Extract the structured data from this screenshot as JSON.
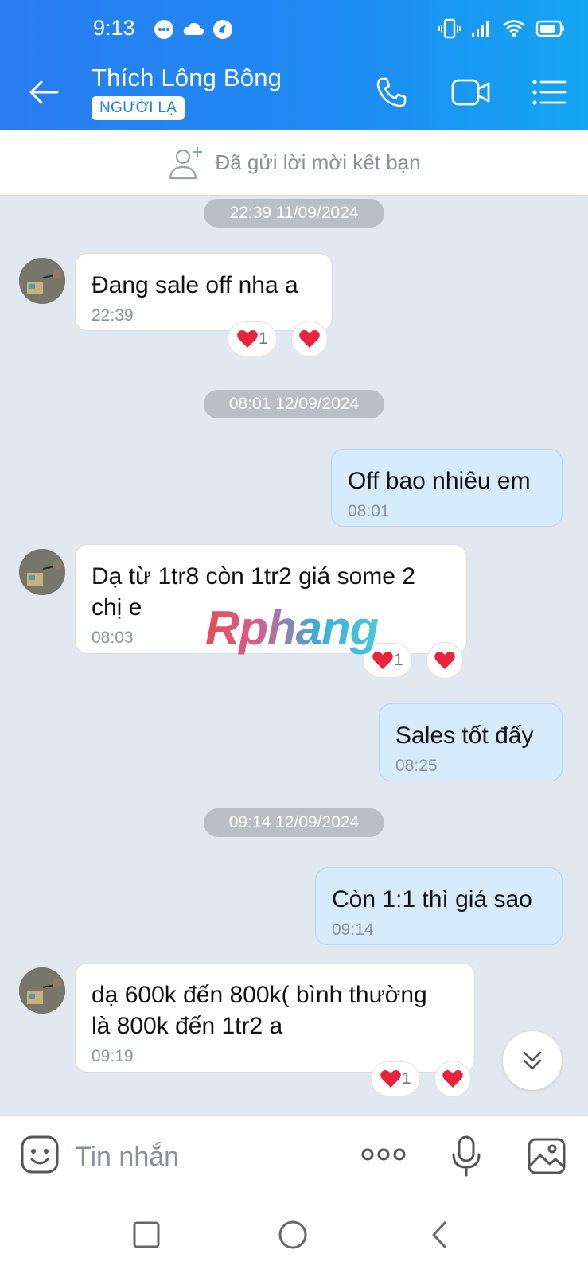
{
  "status_bar": {
    "time": "9:13",
    "icons_left": [
      "messenger-icon",
      "cloud-icon",
      "app-notification-icon"
    ],
    "icons_right": [
      "vibrate-icon",
      "signal-icon",
      "wifi-icon",
      "battery-icon"
    ]
  },
  "header": {
    "name": "Thích Lông Bông",
    "badge": "NGƯỜI LẠ",
    "icons": [
      "back-arrow-icon",
      "phone-icon",
      "video-camera-icon",
      "list-menu-icon"
    ]
  },
  "friend_request": {
    "label": "Đã gửi lời mời kết bạn",
    "icon": "add-person-icon"
  },
  "colors": {
    "header_start": "#2a7cf0",
    "header_end": "#14a6f2",
    "bubble_out": "#d6ecfd",
    "bubble_in": "#ffffff",
    "heart": "#e8243a",
    "chat_bg": "#e2e8ef"
  },
  "messages": [
    {
      "type": "date",
      "label": "22:39 11/09/2024"
    },
    {
      "type": "in",
      "text": "Đang sale off nha a",
      "time": "22:39",
      "reactions": {
        "count": "1",
        "emoji": "heart"
      }
    },
    {
      "type": "date",
      "label": "08:01 12/09/2024"
    },
    {
      "type": "out",
      "text": "Off bao nhiêu em",
      "time": "08:01"
    },
    {
      "type": "in",
      "text_line1": "Dạ từ 1tr8 còn 1tr2 giá some 2",
      "text_line2": "chị e",
      "time": "08:03",
      "reactions": {
        "count": "1",
        "emoji": "heart"
      }
    },
    {
      "type": "out",
      "text": "Sales tốt đấy",
      "time": "08:25"
    },
    {
      "type": "date",
      "label": "09:14 12/09/2024"
    },
    {
      "type": "out",
      "text": "Còn 1:1 thì giá sao",
      "time": "09:14"
    },
    {
      "type": "in",
      "text_line1": "dạ 600k đến 800k( bình thường",
      "text_line2": "là 800k đến 1tr2 a",
      "time": "09:19",
      "reactions": {
        "count": "1",
        "emoji": "heart"
      }
    }
  ],
  "watermark": "Rphang",
  "composer": {
    "placeholder": "Tin nhắn",
    "icons": [
      "sticker-icon",
      "more-dots-icon",
      "microphone-icon",
      "image-icon"
    ]
  },
  "navbar": {
    "icons": [
      "recent-apps-icon",
      "home-icon",
      "back-icon"
    ]
  }
}
